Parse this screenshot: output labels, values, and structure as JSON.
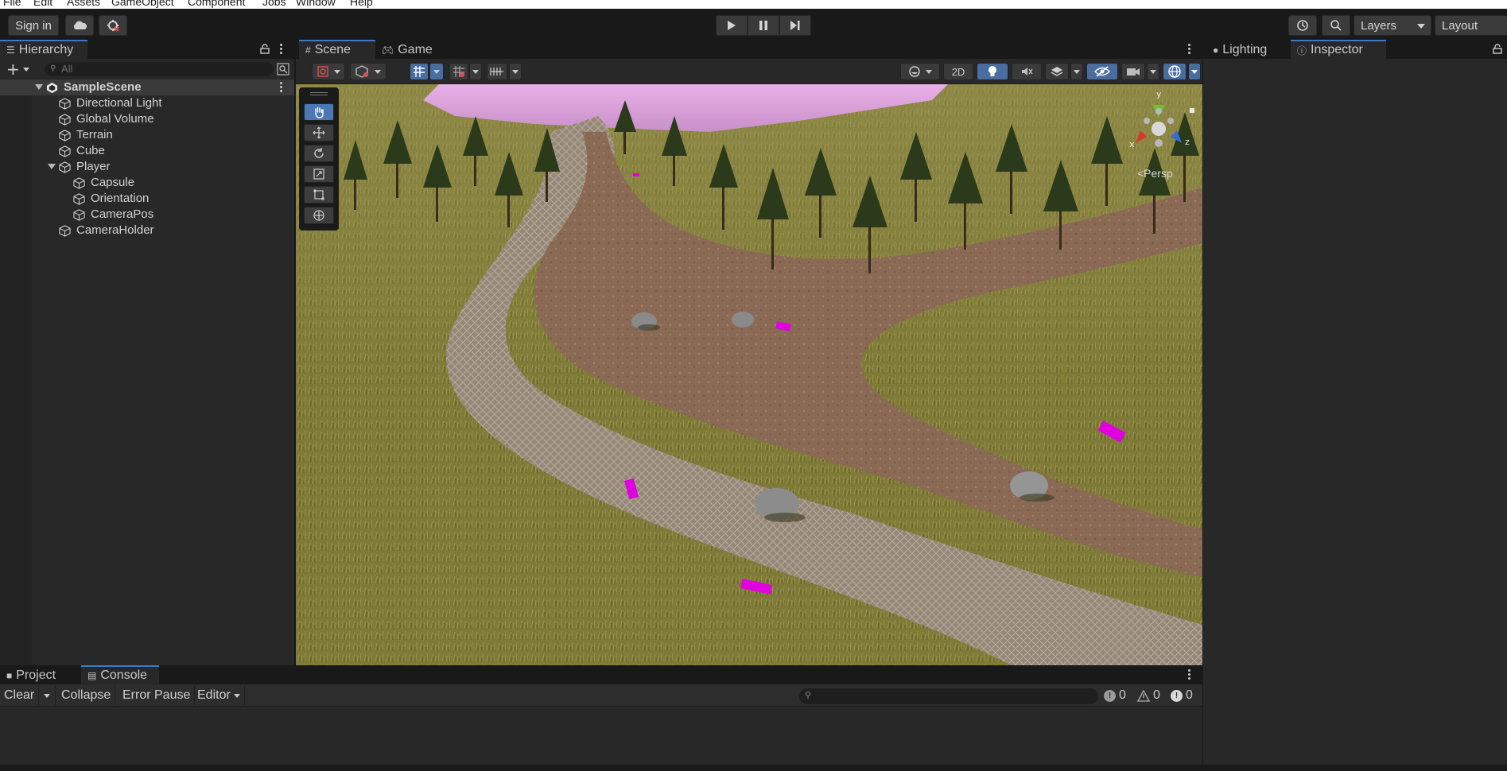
{
  "menu": [
    "File",
    "Edit",
    "Assets",
    "GameObject",
    "Component",
    "Jobs",
    "Window",
    "Help"
  ],
  "toolbar": {
    "sign_in": "Sign in",
    "layers": "Layers",
    "layout": "Layout"
  },
  "hierarchy": {
    "tab": "Hierarchy",
    "search_placeholder": "All",
    "items": [
      {
        "label": "SampleScene",
        "depth": 0
      },
      {
        "label": "Directional Light",
        "depth": 1
      },
      {
        "label": "Global Volume",
        "depth": 1
      },
      {
        "label": "Terrain",
        "depth": 1
      },
      {
        "label": "Cube",
        "depth": 1
      },
      {
        "label": "Player",
        "depth": 1
      },
      {
        "label": "Capsule",
        "depth": 2
      },
      {
        "label": "Orientation",
        "depth": 2
      },
      {
        "label": "CameraPos",
        "depth": 2
      },
      {
        "label": "CameraHolder",
        "depth": 1
      }
    ]
  },
  "scene": {
    "tabs": [
      "Scene",
      "Game"
    ],
    "btn_2d": "2D",
    "gizmo_axes": {
      "x": "x",
      "y": "y",
      "z": "z"
    },
    "persp_label": "<Persp"
  },
  "right": {
    "tabs": [
      "Lighting",
      "Inspector"
    ]
  },
  "console": {
    "tabs": [
      "Project",
      "Console"
    ],
    "clear": "Clear",
    "collapse": "Collapse",
    "error_pause": "Error Pause",
    "editor": "Editor",
    "log_count": "0",
    "warn_count": "0",
    "error_count": "0"
  },
  "colors": {
    "accent": "#3a78c8",
    "grass": "#7a7a32",
    "path": "#8a6e5a",
    "missing_material": "#e000e0",
    "sky": "#d8a0d8"
  }
}
